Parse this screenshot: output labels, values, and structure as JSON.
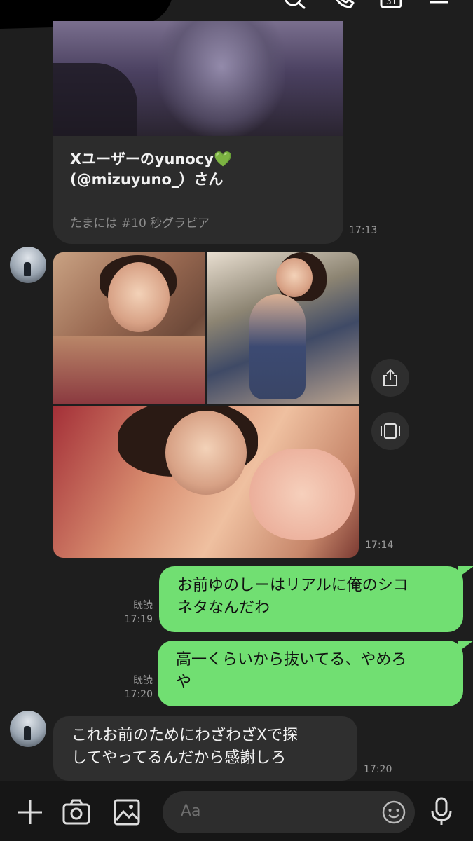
{
  "link_card": {
    "title": "Xユーザーのyunocy💚(@mizuyuno_)さん",
    "title_line1": "Xユーザーのyunocy",
    "title_line2": "(@mizuyuno_）さん",
    "subtitle": "たまには #10 秒グラビア",
    "time": "17:13"
  },
  "photo_group": {
    "time": "17:14",
    "share_icon": "share-icon",
    "album_icon": "album-icon"
  },
  "messages": [
    {
      "side": "mine",
      "status": "既読",
      "time": "17:19",
      "text_line1": "お前ゆのしーはリアルに俺のシコ",
      "text_line2": "ネタなんだわ"
    },
    {
      "side": "mine",
      "status": "既読",
      "time": "17:20",
      "text_line1": "高一くらいから抜いてる、やめろ",
      "text_line2": "や"
    },
    {
      "side": "theirs",
      "time": "17:20",
      "text_line1": "これお前のためにわざわざXで探",
      "text_line2": "してやってるんだから感謝しろ"
    }
  ],
  "input": {
    "placeholder": "Aa"
  },
  "icons": {
    "top": [
      "search-icon",
      "phone-icon",
      "calendar-icon",
      "menu-icon"
    ],
    "bottom": [
      "plus-icon",
      "camera-icon",
      "image-icon",
      "emoji-icon",
      "mic-icon"
    ]
  },
  "colors": {
    "background": "#1e1e1e",
    "my_bubble": "#71df72",
    "their_bubble": "#2f2f2f"
  }
}
